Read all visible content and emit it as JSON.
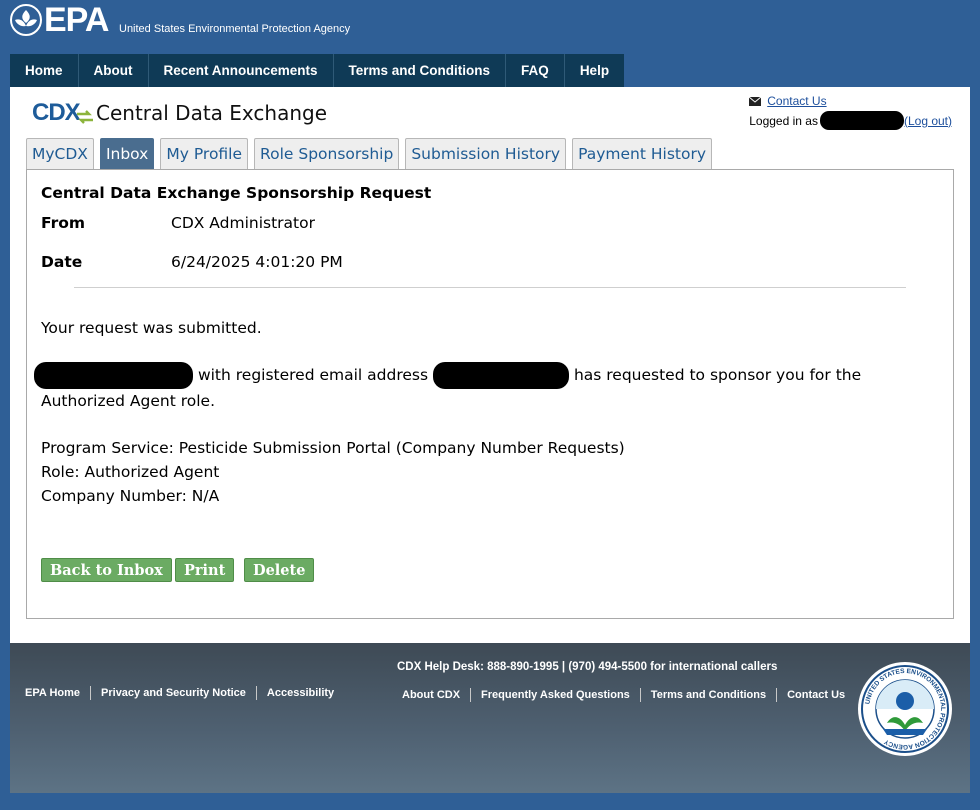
{
  "header": {
    "logo_text": "EPA",
    "tagline": "United States Environmental Protection Agency"
  },
  "nav": [
    "Home",
    "About",
    "Recent Announcements",
    "Terms and Conditions",
    "FAQ",
    "Help"
  ],
  "app": {
    "logo": "CDX",
    "title": "Central Data Exchange"
  },
  "user": {
    "contact_label": "Contact Us",
    "logged_in_prefix": "Logged in as",
    "logout_label": "(Log out)"
  },
  "tabs": [
    {
      "label": "MyCDX",
      "active": false
    },
    {
      "label": "Inbox",
      "active": true
    },
    {
      "label": "My Profile",
      "active": false
    },
    {
      "label": "Role Sponsorship",
      "active": false
    },
    {
      "label": "Submission History",
      "active": false
    },
    {
      "label": "Payment History",
      "active": false
    }
  ],
  "message": {
    "subject": "Central Data Exchange Sponsorship Request",
    "from_label": "From",
    "from_value": "CDX Administrator",
    "date_label": "Date",
    "date_value": "6/24/2025 4:01:20 PM",
    "line1": "Your request was submitted.",
    "para_part1": "with registered email address",
    "para_part2": "has requested to sponsor you for the Authorized Agent role.",
    "program": "Program Service: Pesticide Submission Portal (Company Number Requests)",
    "role": "Role: Authorized Agent",
    "company": "Company Number: N/A"
  },
  "buttons": {
    "back": "Back to Inbox",
    "print": "Print",
    "delete": "Delete"
  },
  "footer": {
    "helpdesk": "CDX Help Desk: 888-890-1995 | (970) 494-5500 for international callers",
    "left_links": [
      "EPA Home",
      "Privacy and Security Notice",
      "Accessibility"
    ],
    "right_links": [
      "About CDX",
      "Frequently Asked Questions",
      "Terms and Conditions",
      "Contact Us"
    ],
    "seal_text": "UNITED STATES ENVIRONMENTAL PROTECTION AGENCY"
  },
  "colors": {
    "page_bg": "#2f5f96",
    "nav_bg": "#0f3a56",
    "tab_active": "#4a6d8f",
    "button_green": "#6bab63",
    "link_blue": "#1d4f9c"
  }
}
